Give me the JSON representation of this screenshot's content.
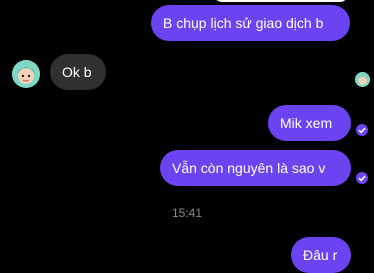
{
  "messages": [
    {
      "text": "B chụp lịch sử giao dịch b",
      "from": "me"
    },
    {
      "text": "Ok b",
      "from": "contact"
    },
    {
      "text": "Mik xem",
      "from": "me"
    },
    {
      "text": "Vẫn còn nguyên là sao v",
      "from": "me"
    },
    {
      "text": "Đâu r",
      "from": "me"
    }
  ],
  "timestamp": "15:41",
  "colors": {
    "background": "#000000",
    "outgoing_bubble": "#6c43f0",
    "incoming_bubble": "#303030",
    "timestamp": "#8a8a8a"
  },
  "icons": {
    "contact_avatar": "avatar-icon",
    "read_receipt": "seen-avatar-icon",
    "delivered": "check-circle-icon"
  }
}
